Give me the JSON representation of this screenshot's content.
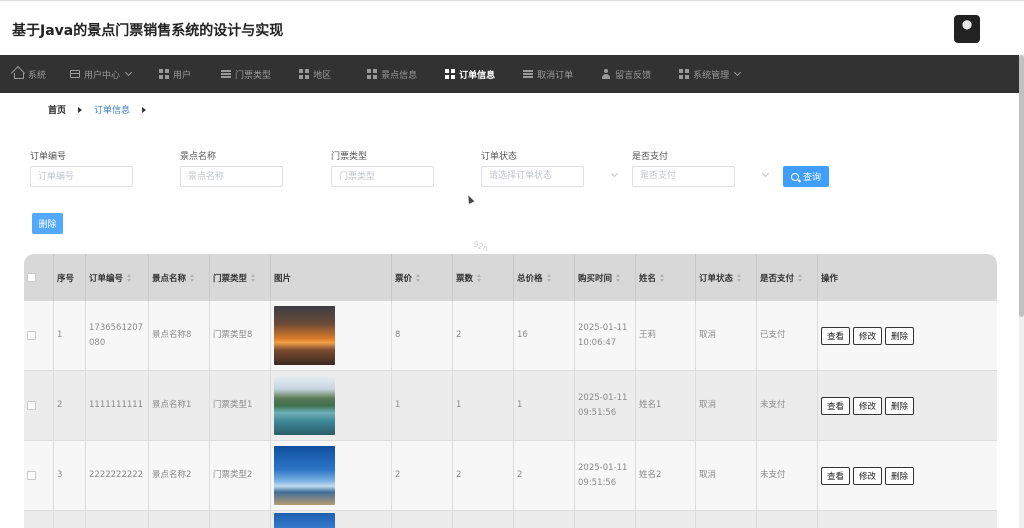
{
  "app": {
    "title": "基于Java的景点门票销售系统的设计与实现"
  },
  "nav": {
    "items": [
      {
        "label": "系统",
        "icon": "home-icon"
      },
      {
        "label": "用户中心",
        "icon": "card-icon"
      },
      {
        "label": "用户",
        "icon": "grid-icon"
      },
      {
        "label": "门票类型",
        "icon": "sliders-icon"
      },
      {
        "label": "地区",
        "icon": "grid-icon"
      },
      {
        "label": "景点信息",
        "icon": "grid-icon"
      },
      {
        "label": "订单信息",
        "icon": "grid-icon",
        "active": true
      },
      {
        "label": "取消订单",
        "icon": "lines-icon"
      },
      {
        "label": "留言反馈",
        "icon": "user-icon"
      },
      {
        "label": "系统管理",
        "icon": "grid-icon"
      }
    ]
  },
  "breadcrumb": {
    "home": "首页",
    "current": "订单信息"
  },
  "search": {
    "order_no": {
      "label": "订单编号",
      "placeholder": "订单编号"
    },
    "spot_name": {
      "label": "景点名称",
      "placeholder": "景点名称"
    },
    "ticket_type": {
      "label": "门票类型",
      "placeholder": "门票类型"
    },
    "order_status": {
      "label": "订单状态",
      "placeholder": "请选择订单状态"
    },
    "is_paid": {
      "label": "是否支付",
      "placeholder": "是否支付"
    },
    "query_label": "查询"
  },
  "actions": {
    "delete_label": "删除"
  },
  "watermark": "92h",
  "table": {
    "headers": {
      "index": "序号",
      "order_no": "订单编号",
      "spot_name": "景点名称",
      "ticket_type": "门票类型",
      "image": "图片",
      "price": "票价",
      "qty": "票数",
      "total": "总价格",
      "buy_time": "购买时间",
      "name": "姓名",
      "status": "订单状态",
      "paid": "是否支付",
      "ops": "操作"
    },
    "op_labels": {
      "view": "查看",
      "edit": "修改",
      "delete": "删除"
    },
    "rows": [
      {
        "index": "1",
        "order_no": "1736561207080",
        "spot_name": "景点名称8",
        "ticket_type": "门票类型8",
        "image": "sunset",
        "price": "8",
        "qty": "2",
        "total": "16",
        "buy_time": "2025-01-11 10:06:47",
        "name": "王莉",
        "status": "取消",
        "paid": "已支付"
      },
      {
        "index": "2",
        "order_no": "1111111111",
        "spot_name": "景点名称1",
        "ticket_type": "门票类型1",
        "image": "lake",
        "price": "1",
        "qty": "1",
        "total": "1",
        "buy_time": "2025-01-11 09:51:56",
        "name": "姓名1",
        "status": "取消",
        "paid": "未支付"
      },
      {
        "index": "3",
        "order_no": "2222222222",
        "spot_name": "景点名称2",
        "ticket_type": "门票类型2",
        "image": "tower",
        "price": "2",
        "qty": "2",
        "total": "2",
        "buy_time": "2025-01-11 09:51:56",
        "name": "姓名2",
        "status": "取消",
        "paid": "未支付"
      }
    ]
  },
  "colors": {
    "nav_bg": "#323232",
    "primary": "#409eff",
    "header_row": "#d8d8d8"
  }
}
